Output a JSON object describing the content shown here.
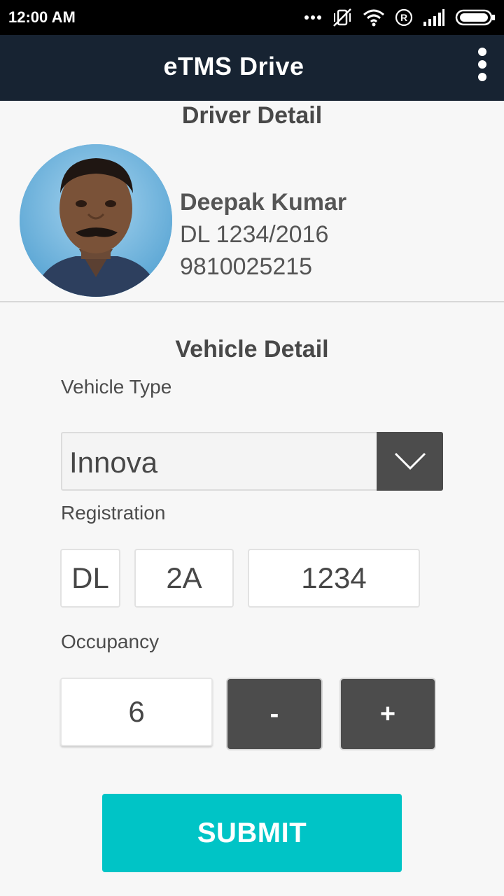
{
  "status_bar": {
    "time": "12:00 AM",
    "icons": [
      "more-dots-icon",
      "vibrate-off-icon",
      "wifi-icon",
      "roaming-r-icon",
      "signal-icon",
      "battery-icon"
    ]
  },
  "app_bar": {
    "title": "eTMS Drive",
    "menu_icon": "overflow-menu-icon",
    "background": "#172332"
  },
  "driver": {
    "section_title": "Driver Detail",
    "name": "Deepak Kumar",
    "license": "DL 1234/2016",
    "phone": "9810025215"
  },
  "vehicle": {
    "section_title": "Vehicle Detail",
    "type_label": "Vehicle Type",
    "type_value": "Innova",
    "registration_label": "Registration",
    "registration": {
      "state": "DL",
      "series": "2A",
      "number": "1234"
    },
    "occupancy_label": "Occupancy",
    "occupancy_value": "6",
    "decrement_label": "-",
    "increment_label": "+"
  },
  "submit_label": "SUBMIT",
  "colors": {
    "accent": "#00c4c6",
    "dark_button": "#4c4c4c"
  }
}
